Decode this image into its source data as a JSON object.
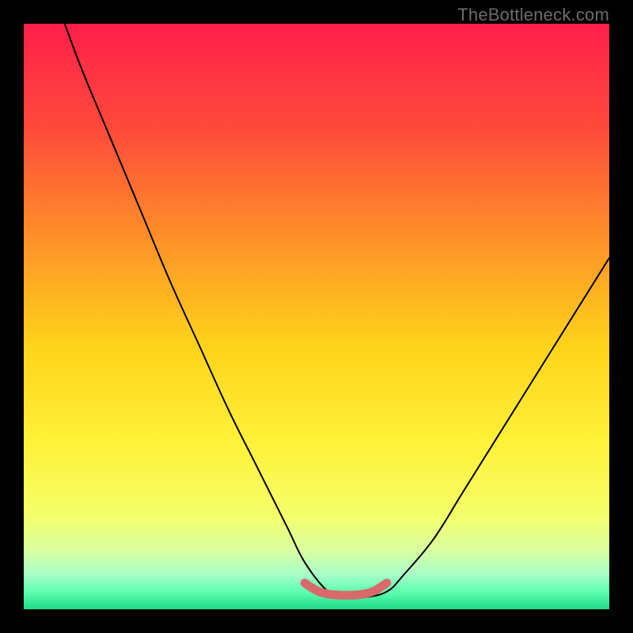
{
  "watermark": "TheBottleneck.com",
  "gradient_stops": [
    {
      "offset": 0.0,
      "color": "#ff1f4b"
    },
    {
      "offset": 0.18,
      "color": "#ff4a3a"
    },
    {
      "offset": 0.35,
      "color": "#ff8a2a"
    },
    {
      "offset": 0.55,
      "color": "#ffd31a"
    },
    {
      "offset": 0.72,
      "color": "#fff23a"
    },
    {
      "offset": 0.84,
      "color": "#f4ff6a"
    },
    {
      "offset": 0.9,
      "color": "#d8ffa0"
    },
    {
      "offset": 0.94,
      "color": "#a8ffc8"
    },
    {
      "offset": 0.97,
      "color": "#5fffb0"
    },
    {
      "offset": 1.0,
      "color": "#1fd98a"
    }
  ],
  "highlight_color": "#d86a6a",
  "curve_color": "#000000",
  "chart_data": {
    "type": "line",
    "title": "",
    "xlabel": "",
    "ylabel": "",
    "xlim": [
      0,
      100
    ],
    "ylim": [
      0,
      100
    ],
    "grid": false,
    "annotations": [
      "TheBottleneck.com"
    ],
    "series": [
      {
        "name": "bottleneck-curve",
        "x": [
          7,
          10,
          15,
          20,
          25,
          30,
          35,
          40,
          45,
          48,
          52,
          55,
          58,
          62,
          65,
          70,
          75,
          80,
          85,
          90,
          95,
          100
        ],
        "y": [
          100,
          92,
          80,
          68,
          56,
          45,
          34,
          24,
          14,
          8,
          3,
          2,
          2,
          3,
          6,
          12,
          20,
          28,
          36,
          44,
          52,
          60
        ]
      },
      {
        "name": "optimal-zone-marker",
        "x": [
          48,
          50,
          52,
          55,
          58,
          60,
          62
        ],
        "y": [
          4.5,
          3.2,
          2.6,
          2.4,
          2.6,
          3.2,
          4.5
        ]
      }
    ]
  }
}
